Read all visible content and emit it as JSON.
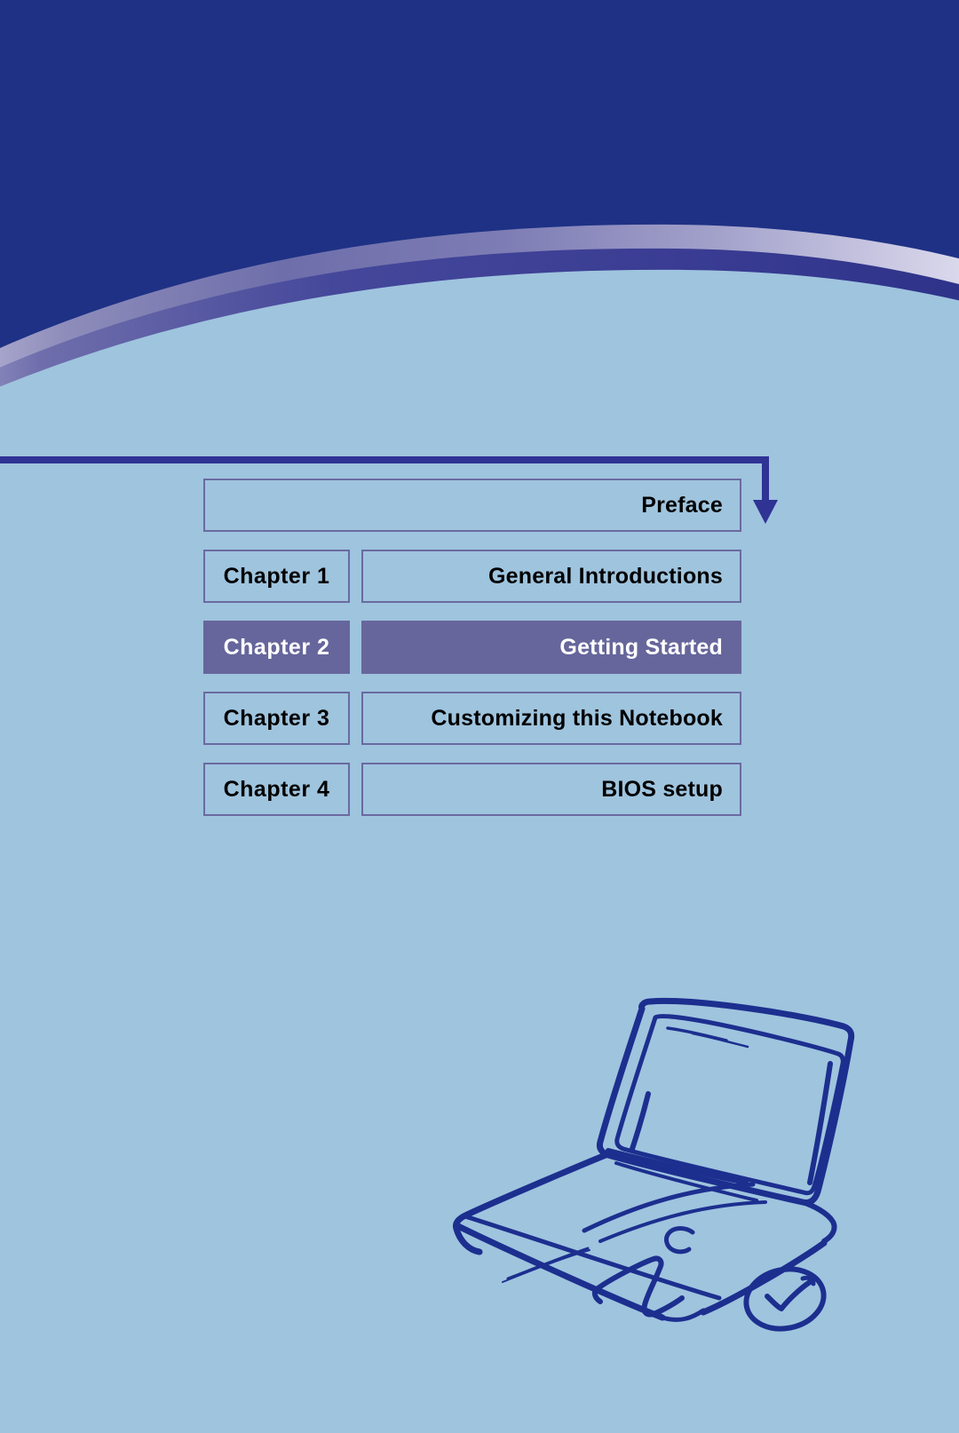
{
  "page": {
    "background_color": "#9fc4de",
    "header_color": "#1e3185",
    "accent_color": "#66669c",
    "sketch_color": "#1c2f8f"
  },
  "chapter_table": {
    "rows": [
      {
        "chapter": "",
        "title": "Preface",
        "active": false,
        "full_width": true
      },
      {
        "chapter": "Chapter  1",
        "title": "General Introductions",
        "active": false,
        "full_width": false
      },
      {
        "chapter": "Chapter  2",
        "title": "Getting Started",
        "active": true,
        "full_width": false
      },
      {
        "chapter": "Chapter  3",
        "title": "Customizing this Notebook",
        "active": false,
        "full_width": false
      },
      {
        "chapter": "Chapter  4",
        "title": "BIOS setup",
        "active": false,
        "full_width": false
      }
    ]
  },
  "decorations": {
    "header_swoosh": "curved-gradient-band",
    "flow_arrow": "down-arrow-pointing-to-preface",
    "laptop": "hand-drawn-open-notebook-sketch",
    "mouse": "hand-drawn-mouse-sketch"
  }
}
